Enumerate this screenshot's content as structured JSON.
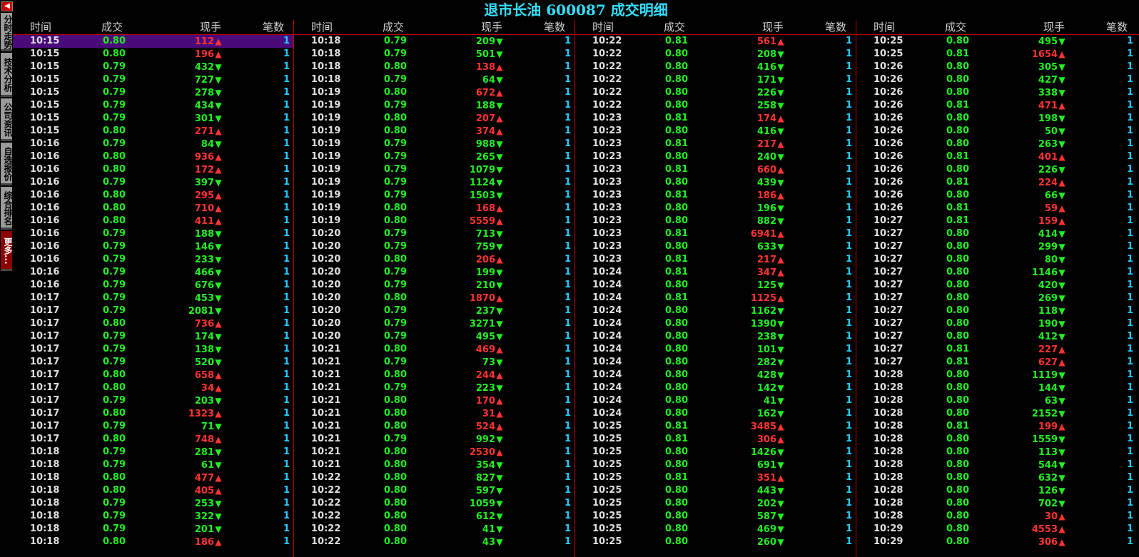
{
  "title": "退市长油 600087 成交明细",
  "sidebar": {
    "tabs": [
      "分时走势",
      "技术分析",
      "公司资讯",
      "自选报价",
      "综合排名",
      "更多..."
    ]
  },
  "headers": [
    "时间",
    "成交",
    "现手",
    "笔数"
  ],
  "colors": {
    "up": "#ff3333",
    "down": "#22ee22",
    "count": "#22ccff",
    "title": "#33e0ff",
    "separator": "#c00000",
    "selected_row": "#4a0a7a"
  },
  "panels": [
    {
      "rows": [
        [
          "10:15",
          "0.80",
          "112",
          "u",
          "1"
        ],
        [
          "10:15",
          "0.80",
          "196",
          "u",
          "1"
        ],
        [
          "10:15",
          "0.79",
          "432",
          "d",
          "1"
        ],
        [
          "10:15",
          "0.79",
          "727",
          "d",
          "1"
        ],
        [
          "10:15",
          "0.79",
          "278",
          "d",
          "1"
        ],
        [
          "10:15",
          "0.79",
          "434",
          "d",
          "1"
        ],
        [
          "10:15",
          "0.79",
          "301",
          "d",
          "1"
        ],
        [
          "10:15",
          "0.80",
          "271",
          "u",
          "1"
        ],
        [
          "10:16",
          "0.79",
          "84",
          "d",
          "1"
        ],
        [
          "10:16",
          "0.80",
          "936",
          "u",
          "1"
        ],
        [
          "10:16",
          "0.80",
          "172",
          "u",
          "1"
        ],
        [
          "10:16",
          "0.79",
          "397",
          "d",
          "1"
        ],
        [
          "10:16",
          "0.80",
          "295",
          "u",
          "1"
        ],
        [
          "10:16",
          "0.80",
          "710",
          "u",
          "1"
        ],
        [
          "10:16",
          "0.80",
          "411",
          "u",
          "1"
        ],
        [
          "10:16",
          "0.79",
          "188",
          "d",
          "1"
        ],
        [
          "10:16",
          "0.79",
          "146",
          "d",
          "1"
        ],
        [
          "10:16",
          "0.79",
          "233",
          "d",
          "1"
        ],
        [
          "10:16",
          "0.79",
          "466",
          "d",
          "1"
        ],
        [
          "10:16",
          "0.79",
          "676",
          "d",
          "1"
        ],
        [
          "10:17",
          "0.79",
          "453",
          "d",
          "1"
        ],
        [
          "10:17",
          "0.79",
          "2081",
          "d",
          "1"
        ],
        [
          "10:17",
          "0.80",
          "736",
          "u",
          "1"
        ],
        [
          "10:17",
          "0.79",
          "174",
          "d",
          "1"
        ],
        [
          "10:17",
          "0.79",
          "138",
          "d",
          "1"
        ],
        [
          "10:17",
          "0.79",
          "520",
          "d",
          "1"
        ],
        [
          "10:17",
          "0.80",
          "658",
          "u",
          "1"
        ],
        [
          "10:17",
          "0.80",
          "34",
          "u",
          "1"
        ],
        [
          "10:17",
          "0.79",
          "203",
          "d",
          "1"
        ],
        [
          "10:17",
          "0.80",
          "1323",
          "u",
          "1"
        ],
        [
          "10:17",
          "0.79",
          "71",
          "d",
          "1"
        ],
        [
          "10:17",
          "0.80",
          "748",
          "u",
          "1"
        ],
        [
          "10:18",
          "0.79",
          "281",
          "d",
          "1"
        ],
        [
          "10:18",
          "0.79",
          "61",
          "d",
          "1"
        ],
        [
          "10:18",
          "0.80",
          "477",
          "u",
          "1"
        ],
        [
          "10:18",
          "0.80",
          "405",
          "u",
          "1"
        ],
        [
          "10:18",
          "0.79",
          "253",
          "d",
          "1"
        ],
        [
          "10:18",
          "0.79",
          "322",
          "d",
          "1"
        ],
        [
          "10:18",
          "0.79",
          "201",
          "d",
          "1"
        ],
        [
          "10:18",
          "0.80",
          "186",
          "u",
          "1"
        ]
      ]
    },
    {
      "rows": [
        [
          "10:18",
          "0.79",
          "209",
          "d",
          "1"
        ],
        [
          "10:18",
          "0.79",
          "501",
          "d",
          "1"
        ],
        [
          "10:18",
          "0.80",
          "138",
          "u",
          "1"
        ],
        [
          "10:18",
          "0.79",
          "64",
          "d",
          "1"
        ],
        [
          "10:19",
          "0.80",
          "672",
          "u",
          "1"
        ],
        [
          "10:19",
          "0.79",
          "188",
          "d",
          "1"
        ],
        [
          "10:19",
          "0.80",
          "207",
          "u",
          "1"
        ],
        [
          "10:19",
          "0.80",
          "374",
          "u",
          "1"
        ],
        [
          "10:19",
          "0.79",
          "988",
          "d",
          "1"
        ],
        [
          "10:19",
          "0.79",
          "265",
          "d",
          "1"
        ],
        [
          "10:19",
          "0.79",
          "1079",
          "d",
          "1"
        ],
        [
          "10:19",
          "0.79",
          "1124",
          "d",
          "1"
        ],
        [
          "10:19",
          "0.79",
          "1503",
          "d",
          "1"
        ],
        [
          "10:19",
          "0.80",
          "168",
          "u",
          "1"
        ],
        [
          "10:19",
          "0.80",
          "5559",
          "u",
          "1"
        ],
        [
          "10:20",
          "0.79",
          "713",
          "d",
          "1"
        ],
        [
          "10:20",
          "0.79",
          "759",
          "d",
          "1"
        ],
        [
          "10:20",
          "0.80",
          "206",
          "u",
          "1"
        ],
        [
          "10:20",
          "0.79",
          "199",
          "d",
          "1"
        ],
        [
          "10:20",
          "0.79",
          "210",
          "d",
          "1"
        ],
        [
          "10:20",
          "0.80",
          "1870",
          "u",
          "1"
        ],
        [
          "10:20",
          "0.79",
          "237",
          "d",
          "1"
        ],
        [
          "10:20",
          "0.79",
          "3271",
          "d",
          "1"
        ],
        [
          "10:20",
          "0.79",
          "495",
          "d",
          "1"
        ],
        [
          "10:21",
          "0.80",
          "469",
          "u",
          "1"
        ],
        [
          "10:21",
          "0.79",
          "73",
          "d",
          "1"
        ],
        [
          "10:21",
          "0.80",
          "244",
          "u",
          "1"
        ],
        [
          "10:21",
          "0.79",
          "223",
          "d",
          "1"
        ],
        [
          "10:21",
          "0.80",
          "170",
          "u",
          "1"
        ],
        [
          "10:21",
          "0.80",
          "31",
          "u",
          "1"
        ],
        [
          "10:21",
          "0.80",
          "524",
          "u",
          "1"
        ],
        [
          "10:21",
          "0.79",
          "992",
          "d",
          "1"
        ],
        [
          "10:21",
          "0.80",
          "2530",
          "u",
          "1"
        ],
        [
          "10:21",
          "0.80",
          "354",
          "d",
          "1"
        ],
        [
          "10:22",
          "0.80",
          "827",
          "d",
          "1"
        ],
        [
          "10:22",
          "0.80",
          "597",
          "d",
          "1"
        ],
        [
          "10:22",
          "0.80",
          "1059",
          "d",
          "1"
        ],
        [
          "10:22",
          "0.80",
          "612",
          "d",
          "1"
        ],
        [
          "10:22",
          "0.80",
          "41",
          "d",
          "1"
        ],
        [
          "10:22",
          "0.80",
          "43",
          "d",
          "1"
        ]
      ]
    },
    {
      "rows": [
        [
          "10:22",
          "0.81",
          "561",
          "u",
          "1"
        ],
        [
          "10:22",
          "0.80",
          "208",
          "d",
          "1"
        ],
        [
          "10:22",
          "0.80",
          "416",
          "d",
          "1"
        ],
        [
          "10:22",
          "0.80",
          "171",
          "d",
          "1"
        ],
        [
          "10:22",
          "0.80",
          "226",
          "d",
          "1"
        ],
        [
          "10:22",
          "0.80",
          "258",
          "d",
          "1"
        ],
        [
          "10:23",
          "0.81",
          "174",
          "u",
          "1"
        ],
        [
          "10:23",
          "0.80",
          "416",
          "d",
          "1"
        ],
        [
          "10:23",
          "0.81",
          "217",
          "u",
          "1"
        ],
        [
          "10:23",
          "0.80",
          "240",
          "d",
          "1"
        ],
        [
          "10:23",
          "0.81",
          "660",
          "u",
          "1"
        ],
        [
          "10:23",
          "0.80",
          "439",
          "d",
          "1"
        ],
        [
          "10:23",
          "0.81",
          "186",
          "u",
          "1"
        ],
        [
          "10:23",
          "0.80",
          "196",
          "d",
          "1"
        ],
        [
          "10:23",
          "0.80",
          "882",
          "d",
          "1"
        ],
        [
          "10:23",
          "0.81",
          "6941",
          "u",
          "1"
        ],
        [
          "10:23",
          "0.80",
          "633",
          "d",
          "1"
        ],
        [
          "10:23",
          "0.81",
          "217",
          "u",
          "1"
        ],
        [
          "10:24",
          "0.81",
          "347",
          "u",
          "1"
        ],
        [
          "10:24",
          "0.80",
          "125",
          "d",
          "1"
        ],
        [
          "10:24",
          "0.81",
          "1125",
          "u",
          "1"
        ],
        [
          "10:24",
          "0.80",
          "1162",
          "d",
          "1"
        ],
        [
          "10:24",
          "0.80",
          "1390",
          "d",
          "1"
        ],
        [
          "10:24",
          "0.80",
          "238",
          "d",
          "1"
        ],
        [
          "10:24",
          "0.80",
          "101",
          "d",
          "1"
        ],
        [
          "10:24",
          "0.80",
          "282",
          "d",
          "1"
        ],
        [
          "10:24",
          "0.80",
          "428",
          "d",
          "1"
        ],
        [
          "10:24",
          "0.80",
          "142",
          "d",
          "1"
        ],
        [
          "10:24",
          "0.80",
          "41",
          "d",
          "1"
        ],
        [
          "10:24",
          "0.80",
          "162",
          "d",
          "1"
        ],
        [
          "10:25",
          "0.81",
          "3485",
          "u",
          "1"
        ],
        [
          "10:25",
          "0.81",
          "306",
          "u",
          "1"
        ],
        [
          "10:25",
          "0.80",
          "1426",
          "d",
          "1"
        ],
        [
          "10:25",
          "0.80",
          "691",
          "d",
          "1"
        ],
        [
          "10:25",
          "0.81",
          "351",
          "u",
          "1"
        ],
        [
          "10:25",
          "0.80",
          "443",
          "d",
          "1"
        ],
        [
          "10:25",
          "0.80",
          "202",
          "d",
          "1"
        ],
        [
          "10:25",
          "0.80",
          "587",
          "d",
          "1"
        ],
        [
          "10:25",
          "0.80",
          "469",
          "d",
          "1"
        ],
        [
          "10:25",
          "0.80",
          "260",
          "d",
          "1"
        ]
      ]
    },
    {
      "rows": [
        [
          "10:25",
          "0.80",
          "495",
          "d",
          "1"
        ],
        [
          "10:25",
          "0.81",
          "1654",
          "u",
          "1"
        ],
        [
          "10:26",
          "0.80",
          "305",
          "d",
          "1"
        ],
        [
          "10:26",
          "0.80",
          "427",
          "d",
          "1"
        ],
        [
          "10:26",
          "0.80",
          "338",
          "d",
          "1"
        ],
        [
          "10:26",
          "0.81",
          "471",
          "u",
          "1"
        ],
        [
          "10:26",
          "0.80",
          "198",
          "d",
          "1"
        ],
        [
          "10:26",
          "0.80",
          "50",
          "d",
          "1"
        ],
        [
          "10:26",
          "0.80",
          "263",
          "d",
          "1"
        ],
        [
          "10:26",
          "0.81",
          "401",
          "u",
          "1"
        ],
        [
          "10:26",
          "0.80",
          "226",
          "d",
          "1"
        ],
        [
          "10:26",
          "0.81",
          "224",
          "u",
          "1"
        ],
        [
          "10:26",
          "0.80",
          "66",
          "d",
          "1"
        ],
        [
          "10:26",
          "0.81",
          "59",
          "u",
          "1"
        ],
        [
          "10:27",
          "0.81",
          "159",
          "u",
          "1"
        ],
        [
          "10:27",
          "0.80",
          "414",
          "d",
          "1"
        ],
        [
          "10:27",
          "0.80",
          "299",
          "d",
          "1"
        ],
        [
          "10:27",
          "0.80",
          "80",
          "d",
          "1"
        ],
        [
          "10:27",
          "0.80",
          "1146",
          "d",
          "1"
        ],
        [
          "10:27",
          "0.80",
          "420",
          "d",
          "1"
        ],
        [
          "10:27",
          "0.80",
          "269",
          "d",
          "1"
        ],
        [
          "10:27",
          "0.80",
          "118",
          "d",
          "1"
        ],
        [
          "10:27",
          "0.80",
          "190",
          "d",
          "1"
        ],
        [
          "10:27",
          "0.80",
          "412",
          "d",
          "1"
        ],
        [
          "10:27",
          "0.81",
          "227",
          "u",
          "1"
        ],
        [
          "10:27",
          "0.81",
          "627",
          "u",
          "1"
        ],
        [
          "10:28",
          "0.80",
          "1119",
          "d",
          "1"
        ],
        [
          "10:28",
          "0.80",
          "144",
          "d",
          "1"
        ],
        [
          "10:28",
          "0.80",
          "63",
          "d",
          "1"
        ],
        [
          "10:28",
          "0.80",
          "2152",
          "d",
          "1"
        ],
        [
          "10:28",
          "0.81",
          "199",
          "u",
          "1"
        ],
        [
          "10:28",
          "0.80",
          "1559",
          "d",
          "1"
        ],
        [
          "10:28",
          "0.80",
          "113",
          "d",
          "1"
        ],
        [
          "10:28",
          "0.80",
          "544",
          "d",
          "1"
        ],
        [
          "10:28",
          "0.80",
          "632",
          "d",
          "1"
        ],
        [
          "10:28",
          "0.80",
          "126",
          "d",
          "1"
        ],
        [
          "10:28",
          "0.80",
          "702",
          "d",
          "1"
        ],
        [
          "10:28",
          "0.80",
          "30",
          "u",
          "1"
        ],
        [
          "10:29",
          "0.80",
          "4553",
          "u",
          "1"
        ],
        [
          "10:29",
          "0.80",
          "306",
          "u",
          "1"
        ]
      ]
    }
  ]
}
